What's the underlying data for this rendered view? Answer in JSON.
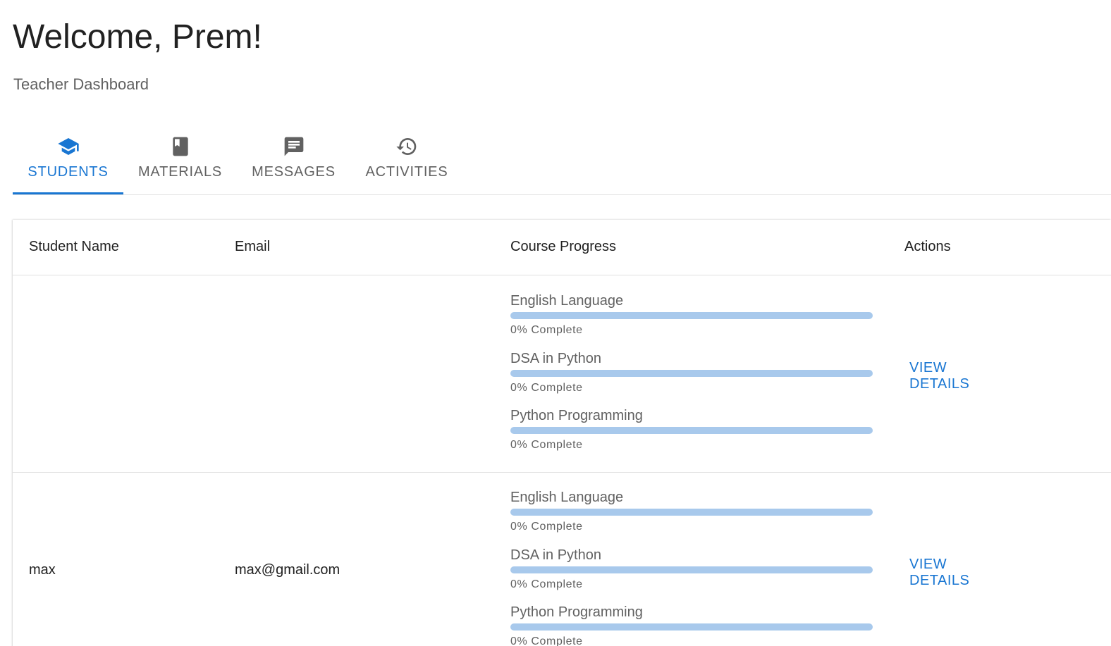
{
  "header": {
    "title": "Welcome, Prem!",
    "subtitle": "Teacher Dashboard"
  },
  "tabs": [
    {
      "label": "STUDENTS",
      "icon": "graduation-cap-icon",
      "active": true
    },
    {
      "label": "MATERIALS",
      "icon": "book-icon",
      "active": false
    },
    {
      "label": "MESSAGES",
      "icon": "message-icon",
      "active": false
    },
    {
      "label": "ACTIVITIES",
      "icon": "history-icon",
      "active": false
    }
  ],
  "colors": {
    "accent": "#1976d2",
    "progress_track": "#a8c9ec",
    "text_primary": "#212121",
    "text_secondary": "#616161"
  },
  "table": {
    "columns": [
      "Student Name",
      "Email",
      "Course Progress",
      "Actions"
    ],
    "rows": [
      {
        "name": "",
        "email": "",
        "courses": [
          {
            "name": "English Language",
            "progress": 0,
            "label": "0% Complete"
          },
          {
            "name": "DSA in Python",
            "progress": 0,
            "label": "0% Complete"
          },
          {
            "name": "Python Programming",
            "progress": 0,
            "label": "0% Complete"
          }
        ],
        "action": "VIEW DETAILS"
      },
      {
        "name": "max",
        "email": "max@gmail.com",
        "courses": [
          {
            "name": "English Language",
            "progress": 0,
            "label": "0% Complete"
          },
          {
            "name": "DSA in Python",
            "progress": 0,
            "label": "0% Complete"
          },
          {
            "name": "Python Programming",
            "progress": 0,
            "label": "0% Complete"
          }
        ],
        "action": "VIEW DETAILS"
      }
    ]
  }
}
